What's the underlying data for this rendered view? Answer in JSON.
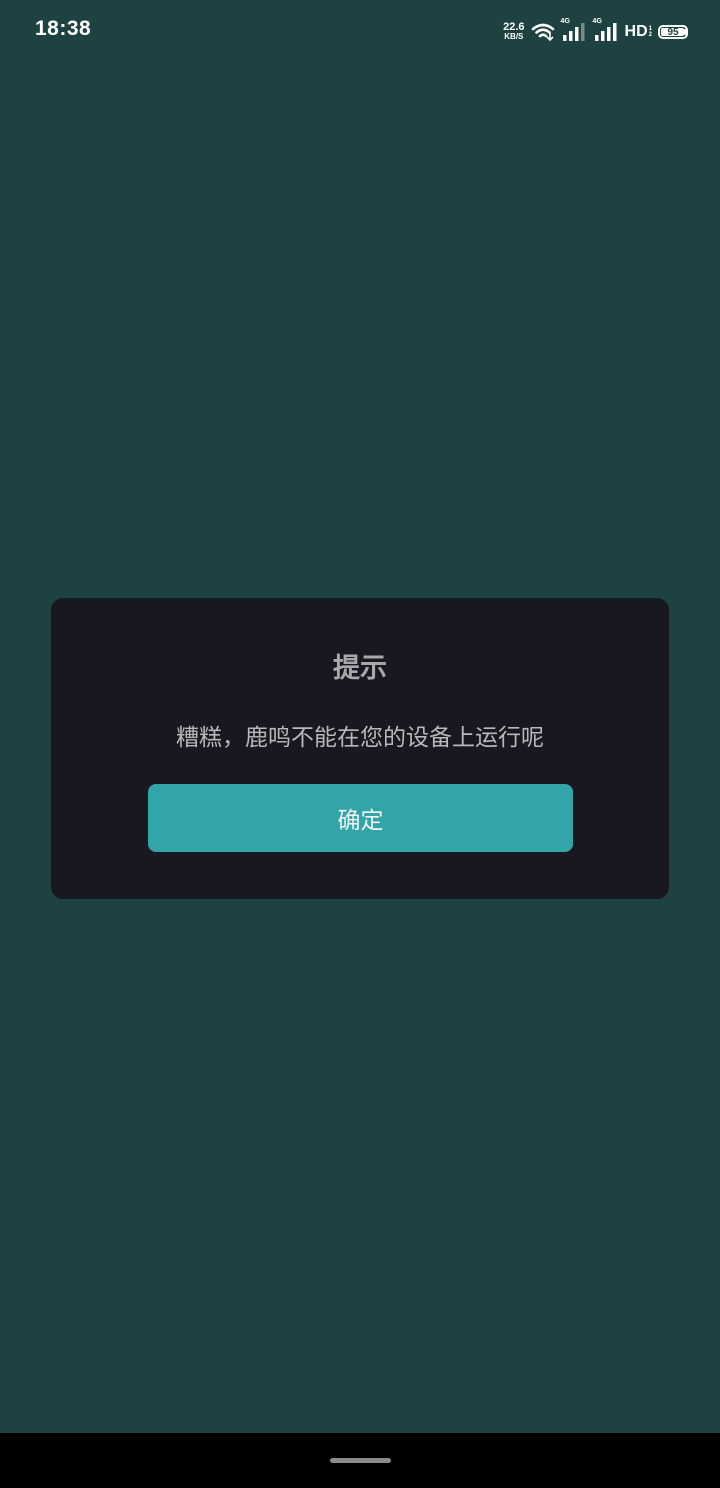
{
  "status_bar": {
    "time": "18:38",
    "net_speed_value": "22.6",
    "net_speed_unit": "KB/S",
    "sim1_tag": "4G",
    "sim2_tag": "4G",
    "hd_label": "HD",
    "hd_sub_top": "1",
    "hd_sub_bottom": "2",
    "battery_level": "95",
    "battery_fraction": 0.95,
    "icons": [
      "wifi-icon",
      "signal-icon",
      "signal-icon",
      "battery-icon"
    ]
  },
  "dialog": {
    "title": "提示",
    "message": "糟糕，鹿鸣不能在您的设备上运行呢",
    "confirm_label": "确定"
  },
  "colors": {
    "background": "#1e4242",
    "dialog_bg": "#181820",
    "accent": "#31a5a7",
    "nav_bar": "#000000"
  }
}
